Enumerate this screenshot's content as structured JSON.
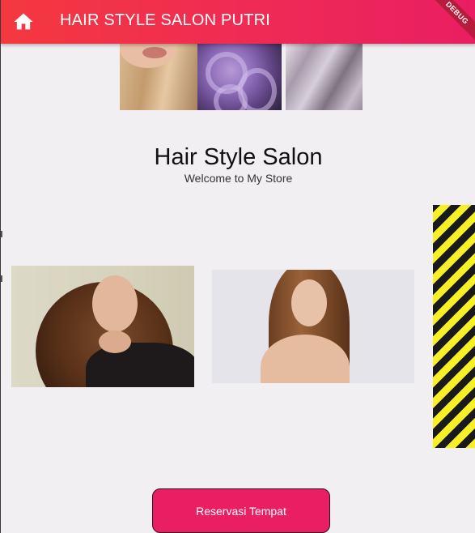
{
  "appbar": {
    "title": "HAIR STYLE SALON PUTRI",
    "home_icon": "home-icon",
    "debug_label": "DEBUG",
    "colors": {
      "start": "#f5383f",
      "end": "#e91e63"
    }
  },
  "main": {
    "heading": "Hair Style Salon",
    "subheading": "Welcome to My Store"
  },
  "actions": {
    "reserve_label": "Reservasi Tempat",
    "reserve_color": "#e91e63"
  }
}
